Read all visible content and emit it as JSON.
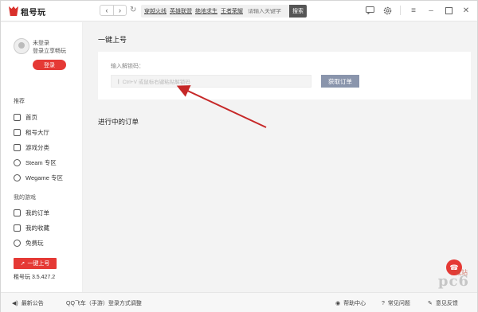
{
  "app": {
    "logo_text": "租号玩"
  },
  "header": {
    "search_tags": [
      "穿越火线",
      "英雄联盟",
      "绝地求生",
      "王者荣耀"
    ],
    "search_placeholder": "请输入关键字",
    "search_button": "搜索"
  },
  "sidebar": {
    "user_name": "未登录",
    "user_hint": "登录立享畅玩",
    "login_button": "登录",
    "section_recommend": "推荐",
    "section_mygame": "我的游戏",
    "items_recommend": [
      {
        "label": "首页",
        "icon": "home-icon"
      },
      {
        "label": "租号大厅",
        "icon": "hall-icon"
      },
      {
        "label": "游戏分类",
        "icon": "grid-icon"
      },
      {
        "label": "Steam 专区",
        "icon": "steam-icon"
      },
      {
        "label": "Wegame 专区",
        "icon": "wegame-icon"
      }
    ],
    "items_mygame": [
      {
        "label": "我的订单",
        "icon": "order-icon"
      },
      {
        "label": "我的收藏",
        "icon": "favorite-icon"
      },
      {
        "label": "免费玩",
        "icon": "free-icon"
      }
    ],
    "onekey_button": "一键上号",
    "version_label": "租号玩 3.5.427.2"
  },
  "main": {
    "title": "一键上号",
    "code_label": "输入解锁码：",
    "code_placeholder": "Ctrl+V 或鼠标右键粘贴解锁码",
    "get_order_button": "获取订单",
    "in_progress_title": "进行中的订单"
  },
  "footer": {
    "news": "最新公告",
    "notice": "QQ飞车（手游）登录方式调整",
    "help_center": "帮助中心",
    "faq": "常见问题",
    "feedback": "意见反馈"
  },
  "watermark": {
    "text": "pc6",
    "sub": "下载站"
  },
  "colors": {
    "accent": "#e53935",
    "button_gray": "#8a95ac",
    "arrow": "#c62828"
  }
}
